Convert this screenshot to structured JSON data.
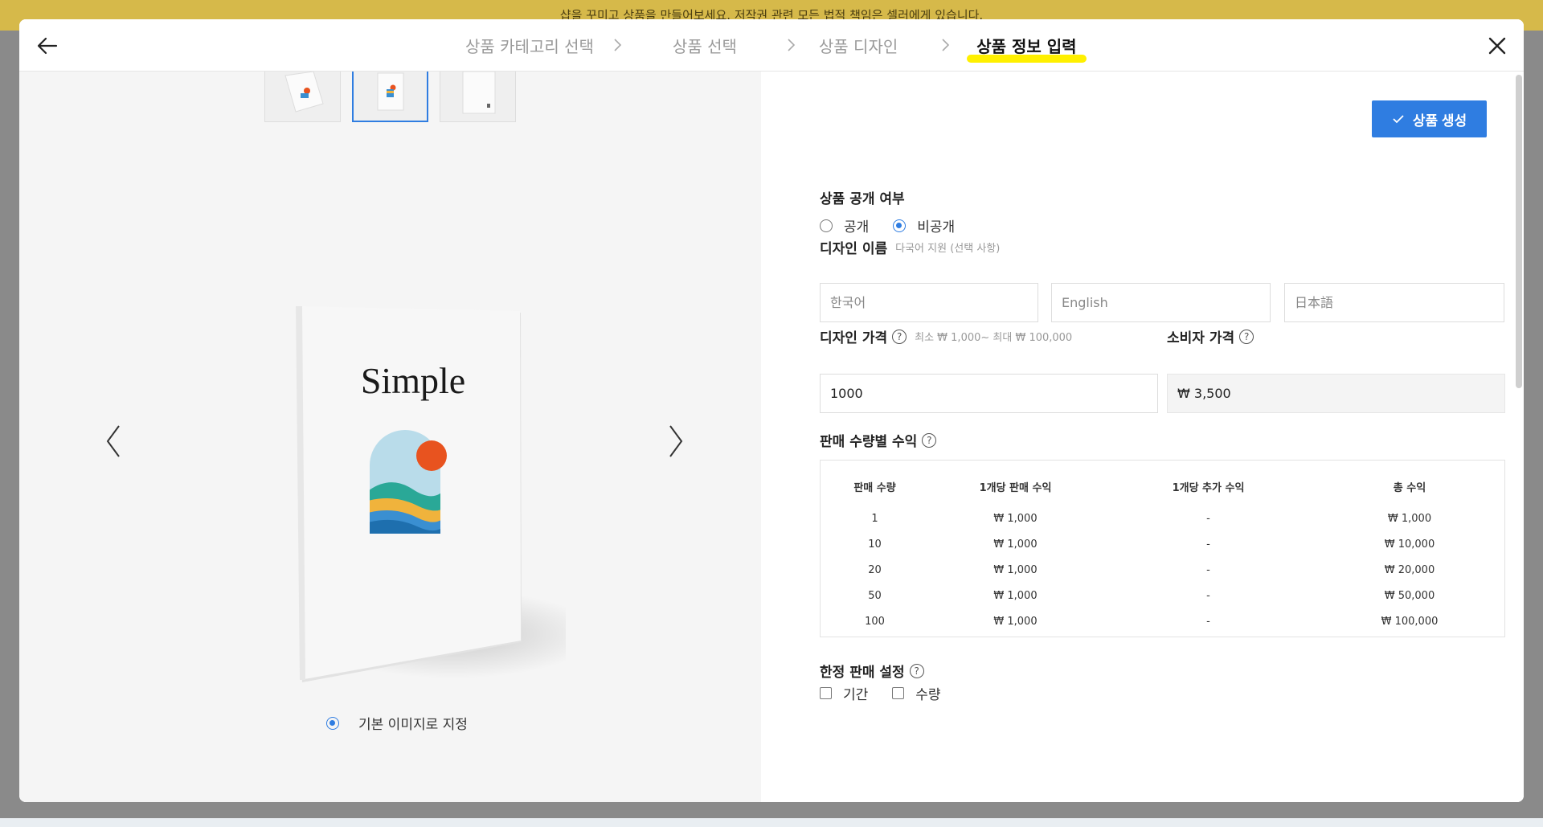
{
  "background": {
    "banner_text": "샵을 꾸미고 상품을 만들어보세요. 저작권 관련 모든 법적 책임은 셀러에게 있습니다."
  },
  "header": {
    "steps": [
      "상품 카테고리 선택",
      "상품 선택",
      "상품 디자인",
      "상품 정보 입력"
    ],
    "active_step": 3
  },
  "preview": {
    "mockup_title": "Simple",
    "default_image_label": "기본 이미지로 지정"
  },
  "form": {
    "create_button": "상품 생성",
    "visibility": {
      "label": "상품 공개 여부",
      "options": [
        "공개",
        "비공개"
      ],
      "selected": "비공개"
    },
    "design_name": {
      "label": "디자인 이름",
      "sublabel": "다국어 지원 (선택 사항)",
      "placeholders": [
        "한국어",
        "English",
        "日本語"
      ]
    },
    "design_price": {
      "label": "디자인 가격",
      "sublabel": "최소 ₩ 1,000~ 최대 ₩ 100,000",
      "value": "1000"
    },
    "consumer_price": {
      "label": "소비자 가격",
      "value": "₩ 3,500"
    },
    "revenue": {
      "label": "판매 수량별 수익",
      "headers": [
        "판매 수량",
        "1개당 판매 수익",
        "1개당 추가 수익",
        "총 수익"
      ],
      "rows": [
        [
          "1",
          "₩ 1,000",
          "-",
          "₩ 1,000"
        ],
        [
          "10",
          "₩ 1,000",
          "-",
          "₩ 10,000"
        ],
        [
          "20",
          "₩ 1,000",
          "-",
          "₩ 20,000"
        ],
        [
          "50",
          "₩ 1,000",
          "-",
          "₩ 50,000"
        ],
        [
          "100",
          "₩ 1,000",
          "-",
          "₩ 100,000"
        ]
      ]
    },
    "limited": {
      "label": "한정 판매 설정",
      "options": [
        "기간",
        "수량"
      ]
    }
  },
  "colors": {
    "accent": "#2f7de1",
    "highlight": "#fff000",
    "banner": "#d6b94a"
  }
}
